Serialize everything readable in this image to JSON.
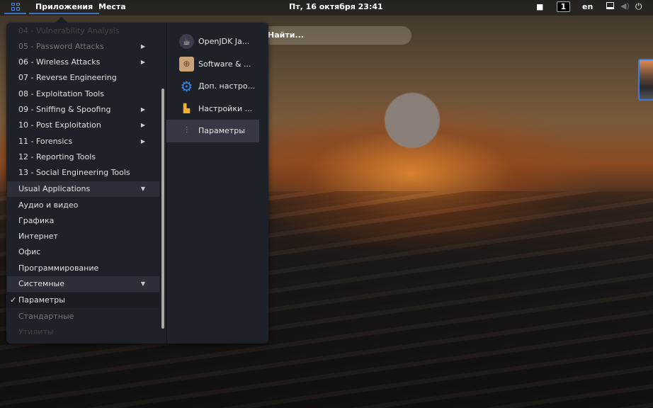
{
  "topbar": {
    "activities_icon": "app-grid-icon",
    "applications": "Приложения",
    "places": "Места",
    "clock": "Пт, 16 октября  23:41",
    "workspace": "1",
    "keyboard_layout": "en",
    "icons": [
      "camera-icon",
      "screen-icon",
      "volume-icon",
      "power-icon"
    ]
  },
  "search": {
    "placeholder": "Найти..."
  },
  "menu": {
    "categories": [
      {
        "label": "04 - Vulnerability Analysis",
        "state": "ghost"
      },
      {
        "label": "05 - Password Attacks",
        "state": "dim",
        "submenu": true
      },
      {
        "label": "06 - Wireless Attacks",
        "submenu": true
      },
      {
        "label": "07 - Reverse Engineering"
      },
      {
        "label": "08 - Exploitation Tools"
      },
      {
        "label": "09 - Sniffing & Spoofing",
        "submenu": true
      },
      {
        "label": "10 - Post Exploitation",
        "submenu": true
      },
      {
        "label": "11 - Forensics",
        "submenu": true
      },
      {
        "label": "12 - Reporting Tools"
      },
      {
        "label": "13 - Social Engineering Tools"
      },
      {
        "label": "Usual Applications",
        "header": true
      },
      {
        "label": "Аудио и видео"
      },
      {
        "label": "Графика"
      },
      {
        "label": "Интернет"
      },
      {
        "label": "Офис"
      },
      {
        "label": "Программирование"
      },
      {
        "label": "Системные",
        "header": true
      },
      {
        "label": "Параметры",
        "checked": true
      },
      {
        "label": "Стандартные",
        "state": "dim"
      },
      {
        "label": "Утилиты",
        "state": "ghost"
      }
    ],
    "apps": [
      {
        "label": "OpenJDK Ja...",
        "icon": "java-icon"
      },
      {
        "label": "Software & ...",
        "icon": "software-icon"
      },
      {
        "label": "Доп. настро...",
        "icon": "gear-icon"
      },
      {
        "label": "Настройки ...",
        "icon": "appearance-icon"
      },
      {
        "label": "Параметры",
        "icon": "settings-icon",
        "selected": true
      }
    ]
  }
}
